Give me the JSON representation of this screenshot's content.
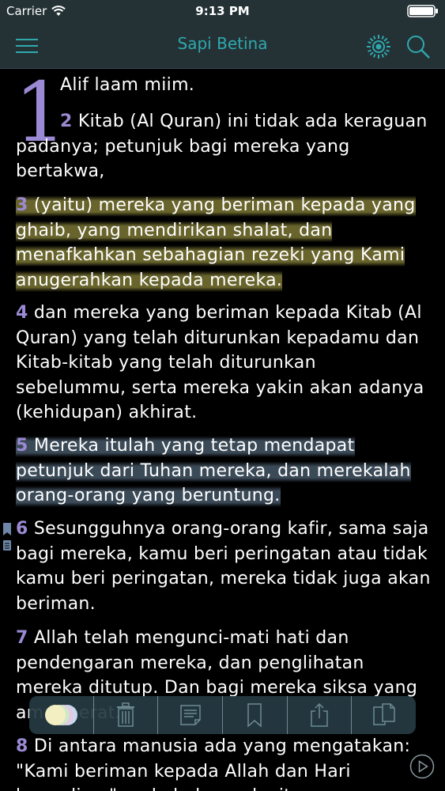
{
  "status_bar": {
    "carrier": "Carrier",
    "time": "9:13 PM"
  },
  "nav": {
    "title": "Sapi Betina",
    "icons": [
      "menu-icon",
      "brightness-icon",
      "search-icon"
    ],
    "title_color": "#2fa9ad"
  },
  "chapter": {
    "drop_cap": "1"
  },
  "verses": [
    {
      "num": "",
      "text": "Alif laam miim."
    },
    {
      "num": "2",
      "text": "Kitab (Al Quran) ini tidak ada keraguan padanya; petunjuk bagi mereka yang bertakwa,"
    },
    {
      "num": "3",
      "text": "(yaitu) mereka yang beriman kepada yang ghaib, yang mendirikan shalat, dan menafkahkan sebahagian rezeki yang Kami anugerahkan kepada mereka."
    },
    {
      "num": "4",
      "text": "dan mereka yang beriman kepada Kitab (Al Quran) yang telah diturunkan kepadamu dan Kitab-kitab yang telah diturunkan sebelummu, serta mereka yakin akan adanya (kehidupan) akhirat."
    },
    {
      "num": "5",
      "text": "Mereka itulah yang tetap mendapat petunjuk dari Tuhan mereka, dan merekalah orang-orang yang beruntung."
    },
    {
      "num": "6",
      "text": "Sesungguhnya orang-orang kafir, sama saja bagi mereka, kamu beri peringatan atau tidak kamu beri peringatan, mereka tidak juga akan beriman."
    },
    {
      "num": "7",
      "text": "Allah telah mengunci-mati hati dan pendengaran mereka, dan penglihatan mereka ditutup. Dan bagi mereka siksa yang amat berat."
    },
    {
      "num": "8",
      "text": "Di antara manusia ada yang mengatakan: \"Kami beriman kepada Allah dan Hari kemudian,\" pada hal mereka itu"
    }
  ],
  "highlight_colors": {
    "yellow": "#7a7634",
    "blue": "#3e4e5c",
    "verse_number": "#9b8ad3"
  },
  "toolbar": {
    "icons": [
      "color-picker-icon",
      "trash-icon",
      "note-icon",
      "bookmark-icon",
      "share-icon",
      "copy-icon"
    ]
  }
}
